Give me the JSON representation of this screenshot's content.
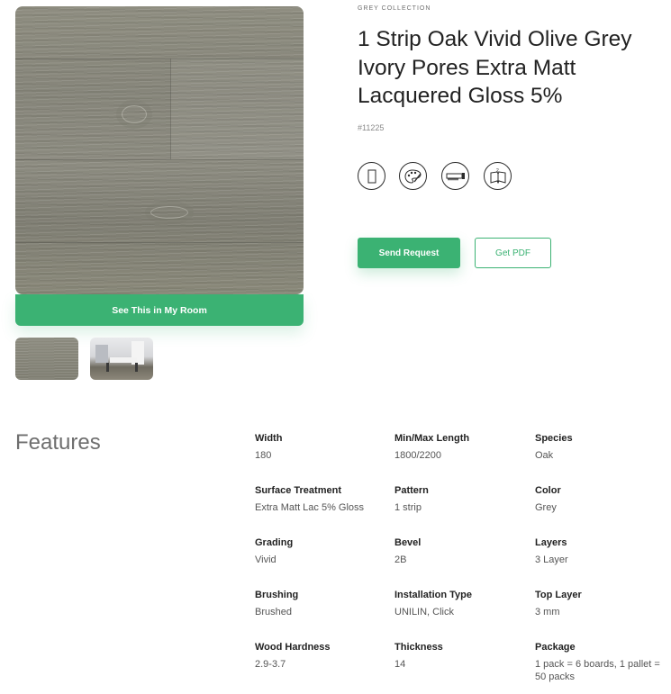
{
  "gallery": {
    "room_button_label": "See This in My Room"
  },
  "product": {
    "collection": "GREY COLLECTION",
    "title": "1 Strip Oak Vivid Olive Grey Ivory Pores Extra Matt Lacquered Gloss 5%",
    "code": "#11225",
    "icons": [
      "plank-icon",
      "palette-icon",
      "saw-icon",
      "book-icon"
    ],
    "send_request_label": "Send Request",
    "get_pdf_label": "Get PDF"
  },
  "features": {
    "heading": "Features",
    "items": [
      {
        "label": "Width",
        "value": "180"
      },
      {
        "label": "Min/Max Length",
        "value": "1800/2200"
      },
      {
        "label": "Species",
        "value": "Oak"
      },
      {
        "label": "Surface Treatment",
        "value": "Extra Matt Lac 5% Gloss"
      },
      {
        "label": "Pattern",
        "value": "1 strip"
      },
      {
        "label": "Color",
        "value": "Grey"
      },
      {
        "label": "Grading",
        "value": "Vivid"
      },
      {
        "label": "Bevel",
        "value": "2B"
      },
      {
        "label": "Layers",
        "value": "3 Layer"
      },
      {
        "label": "Brushing",
        "value": "Brushed"
      },
      {
        "label": "Installation Type",
        "value": "UNILIN, Click"
      },
      {
        "label": "Top Layer",
        "value": "3 mm"
      },
      {
        "label": "Wood Hardness",
        "value": "2.9-3.7"
      },
      {
        "label": "Thickness",
        "value": "14"
      },
      {
        "label": "Package",
        "value": "1 pack = 6 boards, 1 pallet = 50 packs"
      }
    ]
  },
  "colors": {
    "accent": "#3bb273",
    "text_dark": "#222222",
    "text_muted": "#6e6e6e"
  }
}
